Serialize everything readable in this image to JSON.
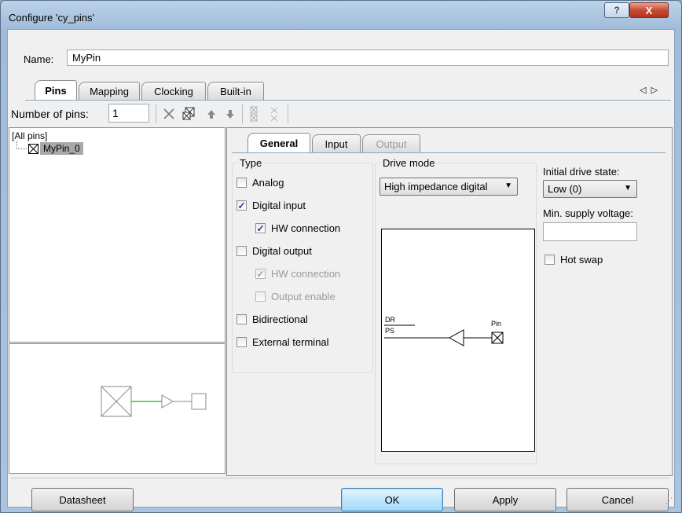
{
  "window": {
    "title": "Configure 'cy_pins'"
  },
  "title_buttons": {
    "help": "?",
    "close": "X"
  },
  "name_field": {
    "label": "Name:",
    "value": "MyPin"
  },
  "top_tabs": [
    {
      "label": "Pins",
      "active": true
    },
    {
      "label": "Mapping",
      "active": false
    },
    {
      "label": "Clocking",
      "active": false
    },
    {
      "label": "Built-in",
      "active": false
    }
  ],
  "tab_nav": {
    "left": "◁",
    "right": "▷"
  },
  "toolbar": {
    "num_pins_label": "Number of pins:",
    "num_pins_value": "1"
  },
  "tree": {
    "root": "[All pins]",
    "item": "MyPin_0"
  },
  "sub_tabs": [
    {
      "label": "General",
      "active": true,
      "enabled": true
    },
    {
      "label": "Input",
      "active": false,
      "enabled": true
    },
    {
      "label": "Output",
      "active": false,
      "enabled": false
    }
  ],
  "type_group": {
    "title": "Type",
    "options": {
      "analog": {
        "label": "Analog",
        "checked": false
      },
      "digital_input": {
        "label": "Digital input",
        "checked": true
      },
      "di_hw": {
        "label": "HW connection",
        "checked": true
      },
      "digital_output": {
        "label": "Digital output",
        "checked": false
      },
      "do_hw": {
        "label": "HW connection",
        "checked": true,
        "disabled": true
      },
      "output_enable": {
        "label": "Output enable",
        "checked": false,
        "disabled": true
      },
      "bidirectional": {
        "label": "Bidirectional",
        "checked": false
      },
      "external_terminal": {
        "label": "External terminal",
        "checked": false
      }
    }
  },
  "drive_mode": {
    "title": "Drive mode",
    "value": "High impedance digital",
    "diagram": {
      "dr": "DR",
      "ps": "PS",
      "pin": "Pin"
    }
  },
  "initial_drive": {
    "label": "Initial drive state:",
    "value": "Low (0)"
  },
  "min_supply": {
    "label": "Min. supply voltage:",
    "value": ""
  },
  "hot_swap": {
    "label": "Hot swap",
    "checked": false
  },
  "buttons": {
    "datasheet": "Datasheet",
    "ok": "OK",
    "apply": "Apply",
    "cancel": "Cancel"
  },
  "colors": {
    "wire_green": "#3cc03c",
    "tab_line": "#8da5c0"
  }
}
